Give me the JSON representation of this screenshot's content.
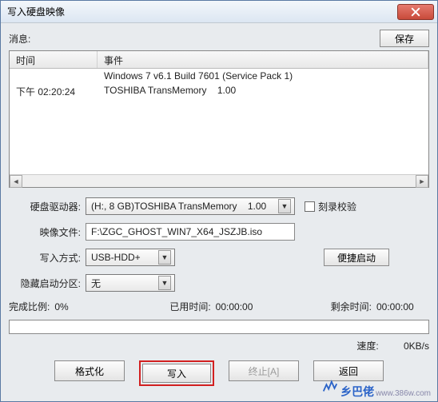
{
  "window": {
    "title": "写入硬盘映像"
  },
  "header": {
    "message_label": "消息:",
    "save_btn": "保存"
  },
  "log": {
    "col_time": "时间",
    "col_event": "事件",
    "rows": [
      {
        "time": "",
        "event": "Windows 7 v6.1 Build 7601 (Service Pack 1)"
      },
      {
        "time": "下午 02:20:24",
        "event": "TOSHIBA TransMemory    1.00"
      }
    ]
  },
  "form": {
    "drive_label": "硬盘驱动器:",
    "drive_value": "(H:, 8 GB)TOSHIBA TransMemory    1.00",
    "verify_label": "刻录校验",
    "image_label": "映像文件:",
    "image_value": "F:\\ZGC_GHOST_WIN7_X64_JSZJB.iso",
    "write_mode_label": "写入方式:",
    "write_mode_value": "USB-HDD+",
    "quick_boot_btn": "便捷启动",
    "hidden_label": "隐藏启动分区:",
    "hidden_value": "无"
  },
  "progress": {
    "ratio_label": "完成比例:",
    "ratio_value": "0%",
    "elapsed_label": "已用时间:",
    "elapsed_value": "00:00:00",
    "remain_label": "剩余时间:",
    "remain_value": "00:00:00",
    "speed_label": "速度:",
    "speed_value": "0KB/s"
  },
  "buttons": {
    "format": "格式化",
    "write": "写入",
    "abort": "终止[A]",
    "return": "返回"
  },
  "watermark": {
    "brand": "乡巴佬",
    "url": "www.386w.com"
  }
}
